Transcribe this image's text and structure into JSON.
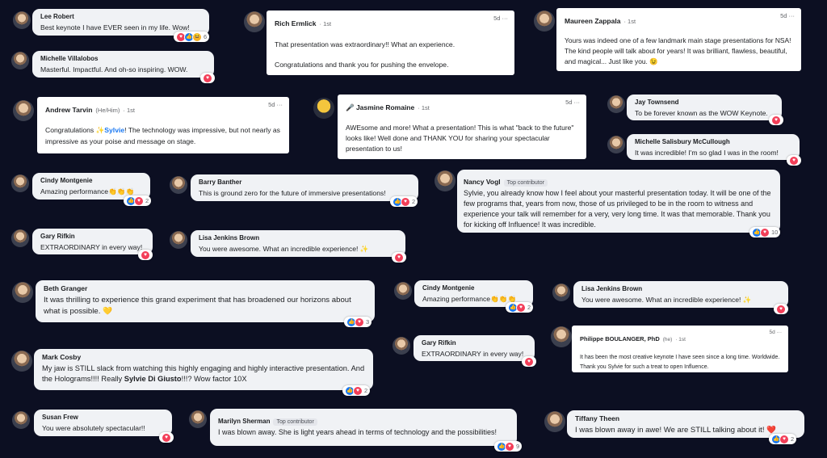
{
  "icons": {
    "like": "👍",
    "love": "♥",
    "care": "😆"
  },
  "comments": {
    "c1": {
      "name": "Lee Robert",
      "text": "Best keynote I have EVER seen in my life. Wow!",
      "reactions": [
        "love",
        "like",
        "care"
      ],
      "count": "6"
    },
    "c2": {
      "name": "Michelle Villalobos",
      "text": "Masterful. Impactful. And oh-so inspiring. WOW.",
      "reactions": [
        "love"
      ],
      "count": ""
    },
    "c3": {
      "name": "Rich Ermlick",
      "meta": "· 1st",
      "time": "5d",
      "menu": "···",
      "line1": "That presentation was extraordinary!! What an experience.",
      "line2": "Congratulations and thank you for pushing the envelope."
    },
    "c4": {
      "name": "Maureen Zappala",
      "meta": "· 1st",
      "time": "5d",
      "menu": "···",
      "text": "Yours was indeed one of a few landmark main stage presentations for NSA! The kind people will talk about for years! It was brilliant, flawless, beautiful, and magical... Just like you. 😉"
    },
    "c5": {
      "name": "Andrew Tarvin",
      "pronoun": "(He/Him)",
      "meta": "· 1st",
      "time": "5d",
      "menu": "···",
      "text_a": "Congratulations ✨",
      "mention": "Sylvie",
      "text_b": "! The technology was impressive, but not nearly as impressive as your poise and message on stage."
    },
    "c6": {
      "name": "🎤 Jasmine Romaine",
      "meta": "· 1st",
      "time": "5d",
      "menu": "···",
      "text": "AWEsome and more! What a presentation! This is what \"back to the future\" looks like! Well done and THANK YOU for sharing your spectacular presentation to us!"
    },
    "c7": {
      "name": "Jay Townsend",
      "text": "To be forever known as the WOW Keynote.",
      "reactions": [
        "love"
      ],
      "count": ""
    },
    "c8": {
      "name": "Michelle Salisbury McCullough",
      "text": "It was incredible! I'm so glad I was in the room!",
      "reactions": [
        "love"
      ],
      "count": ""
    },
    "c9": {
      "name": "Cindy Montgenie",
      "text": "Amazing performance👏👏👏",
      "reactions": [
        "like",
        "love"
      ],
      "count": "2"
    },
    "c10": {
      "name": "Barry Banther",
      "text": "This is ground zero for the future of immersive presentations!",
      "reactions": [
        "like",
        "love"
      ],
      "count": "2"
    },
    "c11": {
      "name": "Nancy Vogl",
      "badge": "Top contributor",
      "text": "Sylvie, you already know how I feel about your masterful presentation today. It will be one of the few programs that, years from now, those of us privileged to be in the room to witness and experience your talk will remember for a very, very long time. It was that memorable. Thank you for kicking off Influence! It was incredible.",
      "reactions": [
        "like",
        "love"
      ],
      "count": "10"
    },
    "c12": {
      "name": "Gary Rifkin",
      "text": "EXTRAORDINARY in every way!",
      "reactions": [
        "love"
      ],
      "count": ""
    },
    "c13": {
      "name": "Lisa Jenkins Brown",
      "text": "You were awesome. What an incredible experience! ✨",
      "reactions": [
        "love"
      ],
      "count": ""
    },
    "c14": {
      "name": "Beth Granger",
      "text": "It was thrilling to experience this grand experiment that has broadened our horizons about what is possible. 💛",
      "reactions": [
        "like",
        "love"
      ],
      "count": "3"
    },
    "c15": {
      "name": "Cindy Montgenie",
      "text": "Amazing performance👏👏👏",
      "reactions": [
        "like",
        "love"
      ],
      "count": "2"
    },
    "c16": {
      "name": "Lisa Jenkins Brown",
      "text": "You were awesome. What an incredible experience! ✨",
      "reactions": [
        "love"
      ],
      "count": ""
    },
    "c17": {
      "name": "Gary Rifkin",
      "text": "EXTRAORDINARY in every way!",
      "reactions": [
        "love"
      ],
      "count": ""
    },
    "c18": {
      "name": "Philippe BOULANGER, PhD",
      "pronoun": "(he)",
      "meta": "· 1st",
      "time": "5d",
      "menu": "···",
      "text": "It has been the most creative keynote I have seen since a long time. Worldwide. Thank you Sylvie for such a treat to open Influence."
    },
    "c19": {
      "name": "Mark Cosby",
      "text_a": "My jaw is STILL slack from watching this highly engaging and highly interactive presentation. And the Holograms!!!! Really ",
      "bold": "Sylvie Di Giusto",
      "text_b": "!!!? Wow factor 10X",
      "reactions": [
        "like",
        "love"
      ],
      "count": "2"
    },
    "c20": {
      "name": "Susan Frew",
      "text": "You were absolutely spectacular!!",
      "reactions": [
        "love"
      ],
      "count": ""
    },
    "c21": {
      "name": "Marilyn Sherman",
      "badge": "Top contributor",
      "text": "I was blown away. She is light years ahead in terms of technology and the possibilities!",
      "reactions": [
        "like",
        "love"
      ],
      "count": "9"
    },
    "c22": {
      "name": "Tiffany Theen",
      "text": "I was blown away in awe! We are STILL talking about it! ❤️",
      "reactions": [
        "like",
        "love"
      ],
      "count": "2"
    }
  }
}
